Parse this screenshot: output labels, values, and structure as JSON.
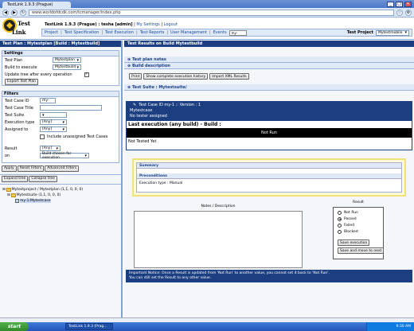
{
  "browser": {
    "tab_title": "TestLink 1.9.3 (Prague)",
    "url": "www.worldofdcdk.com/tcmanager/index.php",
    "win_min": "_",
    "win_max": "□",
    "win_close": "✕"
  },
  "header": {
    "logo_top": "Test",
    "logo_bottom": "Link",
    "app_version": "TestLink 1.9.3 (Prague) : ",
    "user": "tesha [admin]",
    "links": [
      "My Settings",
      "Logout"
    ],
    "menu": [
      "Project",
      "Test Specification",
      "Test Execution",
      "Test Reports",
      "User Management",
      "Events"
    ],
    "search_value": "my-",
    "test_project_label": "Test Project",
    "test_project_value": "Mytestmobile"
  },
  "left": {
    "title": "Test Plan : Mytestplan [Build : Mytestbuild]",
    "settings": {
      "header": "Settings",
      "test_plan_label": "Test Plan",
      "test_plan_value": "Mytestplan",
      "build_label": "Build to execute",
      "build_value": "Mytestbuild",
      "update_tree_label": "Update tree after every operation",
      "export_label": "Export Test Plan"
    },
    "filters": {
      "header": "Filters",
      "tcid_label": "Test Case ID",
      "tcid_value": "my-",
      "tctitle_label": "Test Case Title",
      "suite_label": "Test Suite",
      "exectype_label": "Execution type",
      "exectype_value": "[Any]",
      "assigned_label": "Assigned to",
      "assigned_value": "[Any]",
      "include_unassigned": "Include unassigned Test Cases",
      "result_label": "Result",
      "result_value": "[Any]",
      "on_label": "on",
      "on_value": "Build chosen for execution",
      "apply": "Apply",
      "reset": "Reset Filters",
      "advanced": "Advanced Filters"
    },
    "tree": {
      "expand": "Expand tree",
      "collapse": "Collapse tree",
      "nodes": [
        "Mytestproject / Mytestplan (1,1, 0, 0, 0)",
        "Mytestsuite (1,1, 0, 0, 0)",
        "my-1:Mytestcase"
      ]
    }
  },
  "right": {
    "title": "Test Results on Build Mytestbuild",
    "plan_notes": "Test plan notes",
    "build_desc": "Build description",
    "buttons": [
      "Print",
      "Show complete execution history",
      "Import XML Results"
    ],
    "suite_title": "Test Suite : Mytestsuite/",
    "tc_header": "Test Case ID my-1 :: Version : 1",
    "tc_name": "Mytestcase",
    "tc_assigned": "No tester assigned",
    "last_exec": "Last execution (any build) - Build :",
    "not_run": "Not Run",
    "not_tested": "Not Tested Yet",
    "summary": "Summary",
    "preconditions": "Preconditions",
    "exec_type": "Execution type : Manual",
    "notes_label": "Notes / Description",
    "result_label": "Result",
    "results": [
      "Not Run",
      "Passed",
      "Failed",
      "Blocked"
    ],
    "selected_result": 1,
    "save": "Save execution",
    "save_next": "Save and move to next",
    "info_line1": "Important Notice: Once a Result is updated from 'Not Run' to another value, you cannot set it back to 'Not Run'.",
    "info_line2": "You can still set the Result to any other value."
  },
  "taskbar": {
    "start": "start",
    "task": "TestLink 1.9.3 (Prag...",
    "clock": "9:30 AM"
  }
}
